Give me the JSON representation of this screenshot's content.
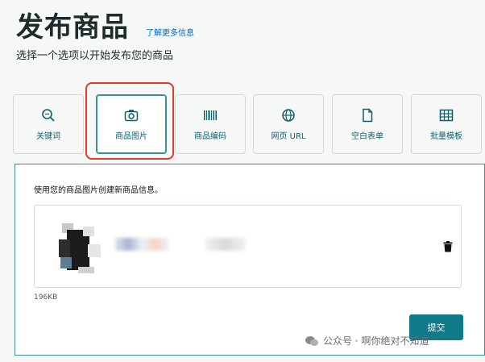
{
  "header": {
    "title": "发布商品",
    "learn_more": "了解更多信息",
    "subtitle": "选择一个选项以开始发布您的商品"
  },
  "tabs": [
    {
      "label": "关键词",
      "icon": "search-icon",
      "selected": false
    },
    {
      "label": "商品图片",
      "icon": "camera-icon",
      "selected": true
    },
    {
      "label": "商品编码",
      "icon": "barcode-icon",
      "selected": false
    },
    {
      "label": "网页 URL",
      "icon": "globe-icon",
      "selected": false
    },
    {
      "label": "空白表单",
      "icon": "document-icon",
      "selected": false
    },
    {
      "label": "批量模板",
      "icon": "spreadsheet-icon",
      "selected": false
    }
  ],
  "panel": {
    "description": "使用您的商品图片创建新商品信息。",
    "file_size": "196KB",
    "submit_label": "提交"
  },
  "colors": {
    "accent": "#0f7b8a",
    "highlight": "#e23a2c",
    "link": "#0066c0"
  },
  "watermark": {
    "text": "公众号 · 啊你绝对不知道"
  }
}
